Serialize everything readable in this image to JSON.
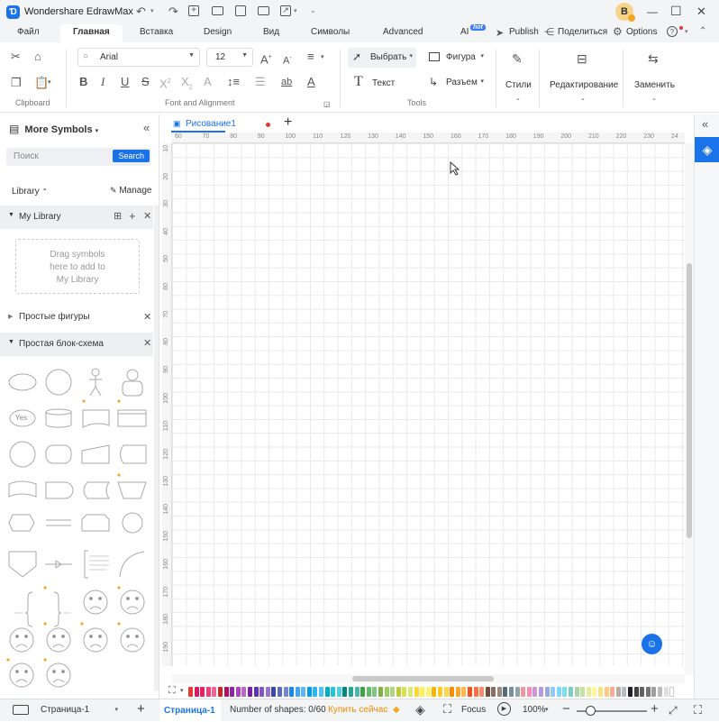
{
  "app": {
    "title": "Wondershare EdrawMax",
    "avatar_letter": "B"
  },
  "titlebar": {
    "win_buttons": [
      "—",
      "☐",
      "✕"
    ]
  },
  "menu": {
    "tabs": [
      "Файл",
      "Главная",
      "Вставка",
      "Design",
      "Вид",
      "Символы",
      "Advanced"
    ],
    "ai_label": "AI",
    "ai_badge": "hot",
    "publish": "Publish",
    "share": "Поделиться",
    "options": "Options",
    "help": "?"
  },
  "ribbon": {
    "font_name": "Arial",
    "font_size": "12",
    "groups": {
      "clipboard": "Clipboard",
      "font": "Font and Alignment",
      "tools": "Tools"
    },
    "tools": {
      "select": "Выбрать",
      "shape": "Фигура",
      "text": "Текст",
      "connector": "Разъем"
    },
    "styles": "Стили",
    "editing": "Редактирование",
    "replace": "Заменить"
  },
  "sidebar": {
    "title": "More Symbols",
    "search_placeholder": "Поиск",
    "search_button": "Search",
    "library_label": "Library",
    "manage": "Manage",
    "my_library": "My Library",
    "drag_hint_1": "Drag symbols",
    "drag_hint_2": "here to add to",
    "drag_hint_3": "My Library",
    "lib_simple_shapes": "Простые фигуры",
    "lib_flowchart": "Простая блок-схема",
    "yes_label": "Yes"
  },
  "document": {
    "tab_name": "Рисование1"
  },
  "rulers": {
    "top": [
      "60",
      "70",
      "80",
      "90",
      "100",
      "110",
      "120",
      "130",
      "140",
      "150",
      "160",
      "170",
      "180",
      "190",
      "200",
      "210",
      "220",
      "230",
      "24"
    ],
    "left": [
      "10",
      "20",
      "30",
      "40",
      "50",
      "60",
      "70",
      "80",
      "90",
      "100",
      "110",
      "120",
      "130",
      "140",
      "150",
      "160",
      "170",
      "180",
      "190"
    ]
  },
  "palette": [
    "#e53935",
    "#d81b60",
    "#e91e63",
    "#ec407a",
    "#f06292",
    "#c62828",
    "#ad1457",
    "#8e24aa",
    "#ab47bc",
    "#ba68c8",
    "#7b1fa2",
    "#5e35b1",
    "#7e57c2",
    "#9575cd",
    "#3949ab",
    "#5c6bc0",
    "#7986cb",
    "#1e88e5",
    "#42a5f5",
    "#64b5f6",
    "#039be5",
    "#29b6f6",
    "#4fc3f7",
    "#00acc1",
    "#26c6da",
    "#4dd0e1",
    "#00897b",
    "#26a69a",
    "#4db6ac",
    "#43a047",
    "#66bb6a",
    "#81c784",
    "#7cb342",
    "#9ccc65",
    "#aed581",
    "#c0ca33",
    "#d4e157",
    "#dce775",
    "#fdd835",
    "#ffee58",
    "#fff176",
    "#ffb300",
    "#ffca28",
    "#ffd54f",
    "#fb8c00",
    "#ffa726",
    "#ffb74d",
    "#f4511e",
    "#ff7043",
    "#ff8a65",
    "#6d4c41",
    "#8d6e63",
    "#a1887f",
    "#546e7a",
    "#78909c",
    "#90a4ae",
    "#ef9a9a",
    "#f48fb1",
    "#ce93d8",
    "#b39ddb",
    "#9fa8da",
    "#90caf9",
    "#81d4fa",
    "#80deea",
    "#80cbc4",
    "#a5d6a7",
    "#c5e1a5",
    "#e6ee9c",
    "#fff59d",
    "#ffe082",
    "#ffcc80",
    "#ffab91",
    "#bcaaa4",
    "#b0bec5",
    "#212121",
    "#424242",
    "#616161",
    "#757575",
    "#9e9e9e",
    "#bdbdbd",
    "#e0e0e0",
    "#ffffff"
  ],
  "status": {
    "page_select": "Страница-1",
    "page_tab": "Страница-1",
    "shape_count": "Number of shapes: 0/60",
    "buy": "Купить сейчас",
    "focus": "Focus",
    "zoom": "100%"
  }
}
